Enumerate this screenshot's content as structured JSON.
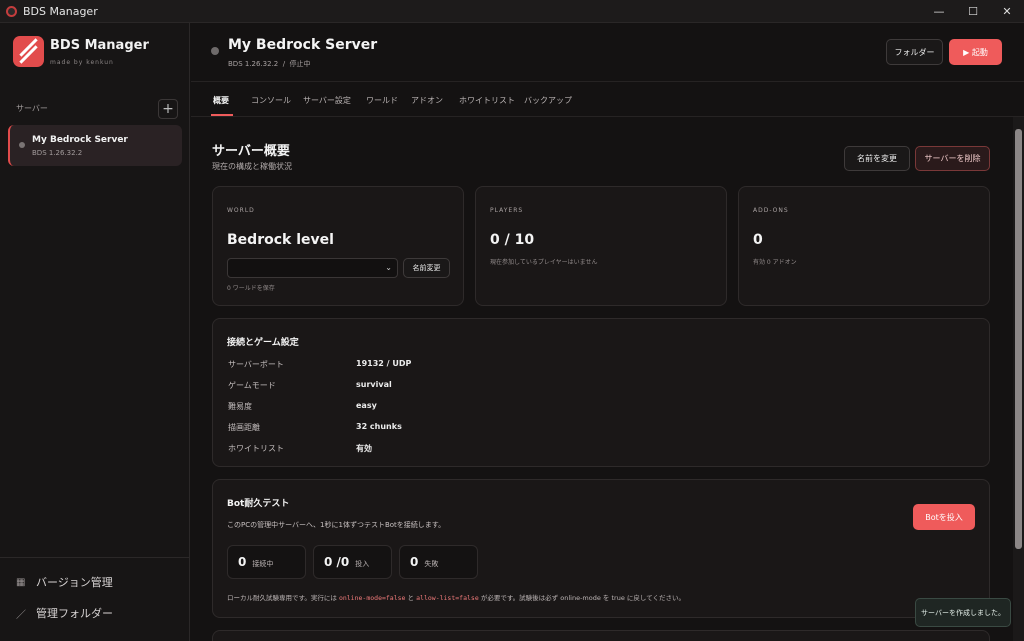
{
  "window": {
    "title": "BDS Manager"
  },
  "brand": {
    "name": "BDS Manager",
    "sub": "made by kenkun"
  },
  "sidebar": {
    "section_label": "サーバー",
    "add_label": "+",
    "servers": [
      {
        "name": "My Bedrock Server",
        "version": "BDS 1.26.32.2"
      }
    ],
    "links": [
      {
        "label": "バージョン管理",
        "icon": "grid-icon"
      },
      {
        "label": "管理フォルダー",
        "icon": "folder-icon"
      }
    ]
  },
  "header": {
    "title": "My Bedrock Server",
    "version": "BDS 1.26.32.2",
    "separator": "/",
    "status": "停止中",
    "folder_button": "フォルダー",
    "start_button": "▶ 起動",
    "status_color": "#6e6a6a",
    "accent": "#ef5b5b"
  },
  "tabs": [
    "概要",
    "コンソール",
    "サーバー設定",
    "ワールド",
    "アドオン",
    "ホワイトリスト",
    "バックアップ"
  ],
  "overview": {
    "title": "サーバー概要",
    "subtitle": "現在の構成と稼働状況",
    "rename_button": "名前を変更",
    "delete_button": "サーバーを削除"
  },
  "world_card": {
    "label": "WORLD",
    "name": "Bedrock level",
    "rename_button": "名前変更",
    "saved_note": "0 ワールドを保存"
  },
  "players_card": {
    "label": "PLAYERS",
    "value": "0 / 10",
    "note": "現在参加しているプレイヤーはいません"
  },
  "addons_card": {
    "label": "ADD-ONS",
    "value": "0",
    "note": "有効 0 アドオン"
  },
  "connection": {
    "title": "接続とゲーム設定",
    "rows": [
      {
        "key": "サーバーポート",
        "value": "19132 / UDP"
      },
      {
        "key": "ゲームモード",
        "value": "survival"
      },
      {
        "key": "難易度",
        "value": "easy"
      },
      {
        "key": "描画距離",
        "value": "32 chunks"
      },
      {
        "key": "ホワイトリスト",
        "value": "有効"
      }
    ]
  },
  "bot_test": {
    "title": "Bot耐久テスト",
    "description": "このPCの管理中サーバーへ、1秒に1体ずつテストBotを接続します。",
    "deploy_button": "Botを投入",
    "stats": [
      {
        "value": "0",
        "label": "接続中"
      },
      {
        "value": "0 /0",
        "label": "投入"
      },
      {
        "value": "0",
        "label": "失敗"
      }
    ],
    "note_prefix": "ローカル耐久試験専用です。実行には",
    "note_code1": "online-mode=false",
    "note_mid": "と",
    "note_code2": "allow-list=false",
    "note_suffix": "が必要です。試験後は必ず online-mode を true に戻してください。"
  },
  "toast": {
    "message": "サーバーを作成しました。"
  }
}
